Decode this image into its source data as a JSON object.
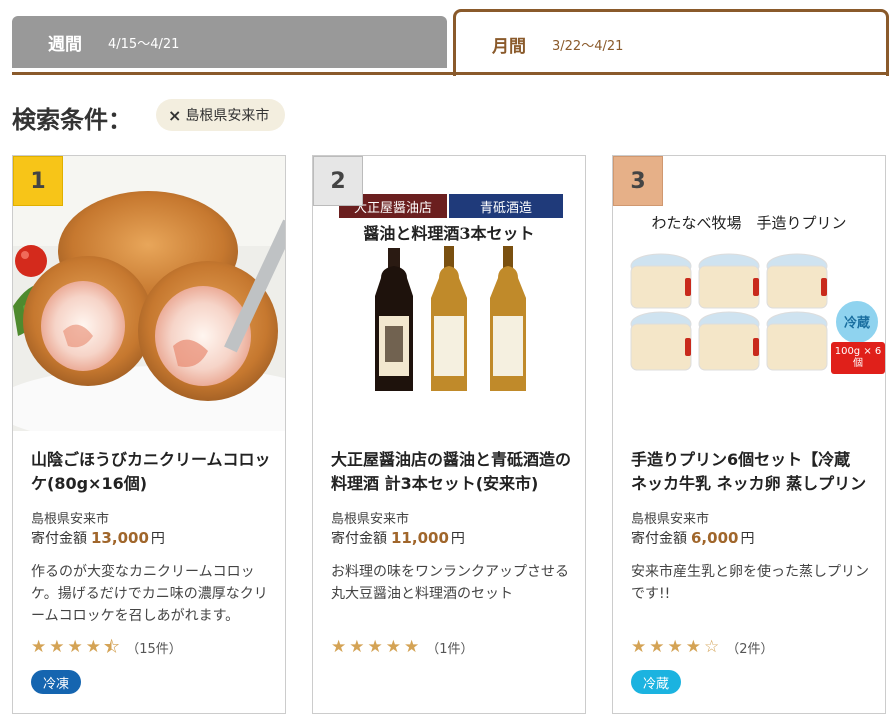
{
  "tabs": {
    "weekly": {
      "label": "週間",
      "range": "4/15〜4/21"
    },
    "monthly": {
      "label": "月間",
      "range": "3/22〜4/21",
      "active": true
    }
  },
  "search": {
    "title": "検索条件：",
    "chip": {
      "close": "×",
      "label": "島根県安来市"
    }
  },
  "colors": {
    "accent": "#8a5a2b",
    "price": "#a0662b",
    "gold": "#f7c518",
    "silver": "#e6e6e6",
    "bronze": "#e6b088",
    "frozen": "#1565b0",
    "chilled": "#1bb3e0"
  },
  "cards": [
    {
      "rank": "1",
      "image": "crab-cream-croquette-photo",
      "title": "山陰ごほうびカニクリームコロッケ(80g×16個)",
      "place": "島根県安来市",
      "price_label": "寄付金額",
      "price": "13,000",
      "yen": "円",
      "desc": "作るのが大変なカニクリームコロッケ。揚げるだけでカニ味の濃厚なクリームコロッケを召しあがれます。",
      "rating": 4.5,
      "stars": "★★★★½",
      "count": "（15件）",
      "tag": "冷凍"
    },
    {
      "rank": "2",
      "image": "soy-sauce-sake-bottles-photo",
      "img_text1": "大正屋醤油店",
      "img_text2": "青砥酒造",
      "img_text3": "醤油と料理酒3本セット",
      "title": "大正屋醤油店の醤油と青砥酒造の料理酒 計3本セット(安来市)",
      "place": "島根県安来市",
      "price_label": "寄付金額",
      "price": "11,000",
      "yen": "円",
      "desc": "お料理の味をワンランクアップさせる丸大豆醤油と料理酒のセット",
      "rating": 5,
      "count": "（1件）",
      "tag": ""
    },
    {
      "rank": "3",
      "image": "pudding-cups-photo",
      "img_text1": "わたなべ牧場　手造りプリン",
      "img_cold": "冷蔵",
      "img_qty": "100g × 6個",
      "title": "手造りプリン6個セット【冷蔵 ネッカ牛乳 ネッカ卵 蒸しプリン …",
      "place": "島根県安来市",
      "price_label": "寄付金額",
      "price": "6,000",
      "yen": "円",
      "desc": "安来市産生乳と卵を使った蒸しプリンです!!",
      "rating": 4,
      "count": "（2件）",
      "tag": "冷蔵"
    }
  ]
}
